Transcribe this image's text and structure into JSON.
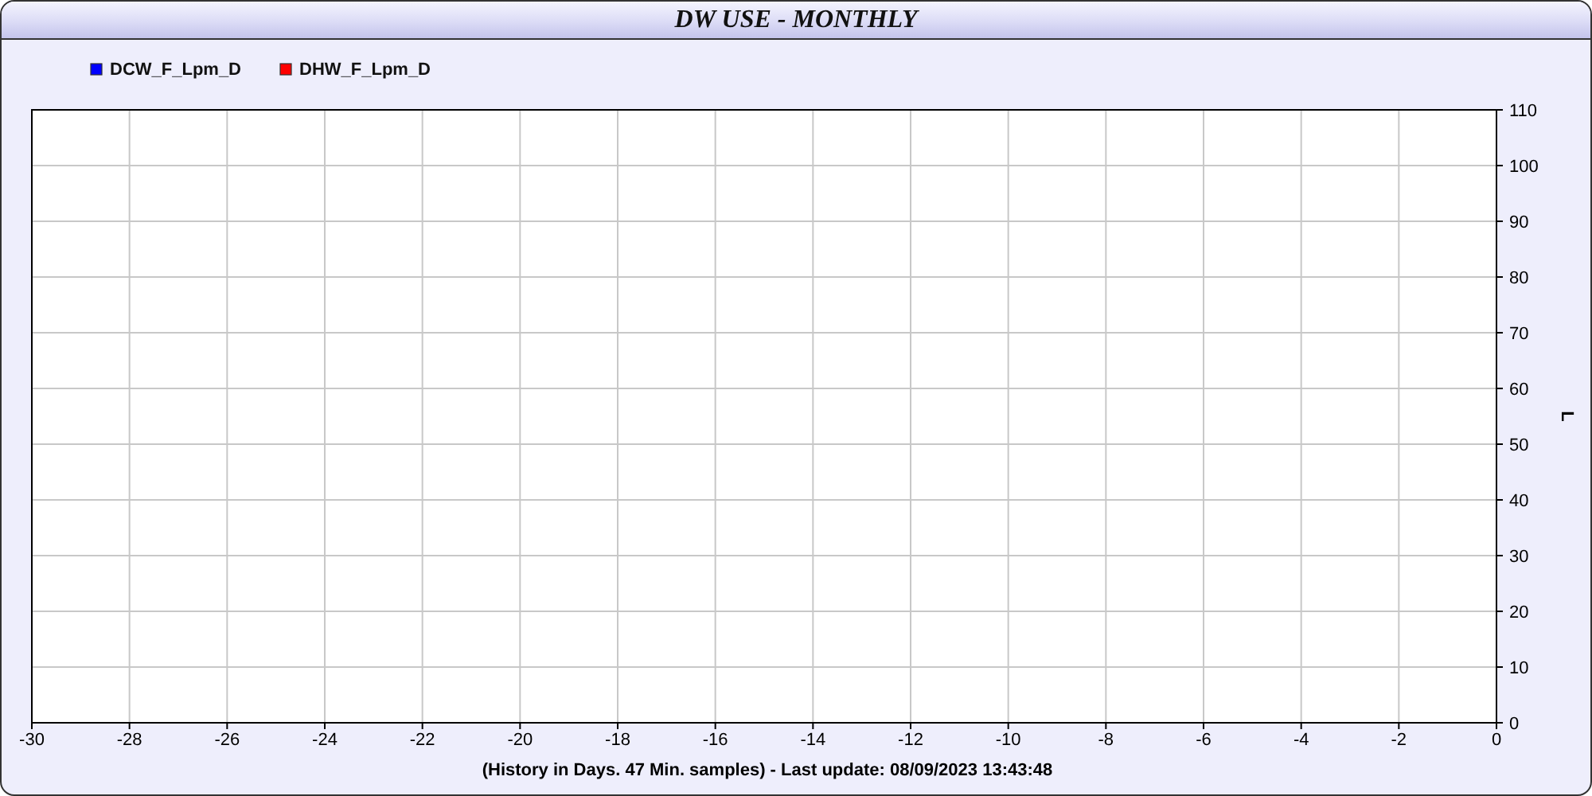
{
  "window": {
    "title": "DW USE - MONTHLY"
  },
  "chart": {
    "chart_data": {
      "type": "line",
      "xlabel": "(History in Days. 47 Min. samples) - Last update: 08/09/2023 13:43:48",
      "ylabel": "L",
      "grid": true,
      "categories": [
        "-30",
        "-28",
        "-26",
        "-24",
        "-22",
        "-20",
        "-18",
        "-16",
        "-14",
        "-12",
        "-10",
        "-8",
        "-6",
        "-4",
        "-2",
        "0"
      ],
      "ylim": [
        0,
        110
      ],
      "yticks": [
        0,
        10,
        20,
        30,
        40,
        50,
        60,
        70,
        80,
        90,
        100,
        110
      ],
      "series": [
        {
          "name": "DCW_F_Lpm_D",
          "color": "#0000ff",
          "values": [
            null,
            null,
            null,
            null,
            null,
            null,
            null,
            null,
            null,
            null,
            null,
            null,
            null,
            null,
            null,
            null
          ]
        },
        {
          "name": "DHW_F_Lpm_D",
          "color": "#ff0000",
          "values": [
            null,
            null,
            null,
            null,
            null,
            null,
            null,
            null,
            null,
            null,
            null,
            null,
            null,
            null,
            null,
            null
          ]
        }
      ]
    }
  }
}
